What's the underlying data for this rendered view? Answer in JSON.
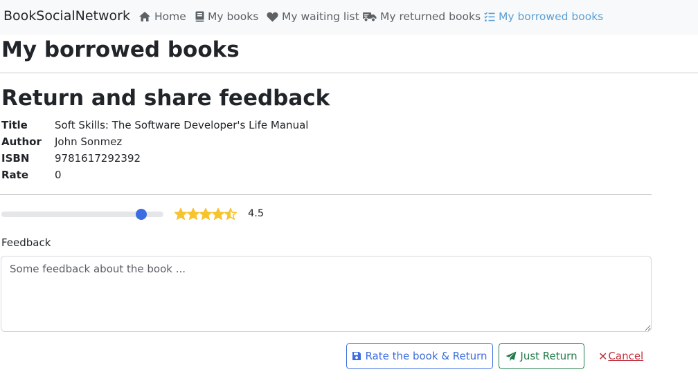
{
  "navbar": {
    "brand": "BookSocialNetwork",
    "items": [
      {
        "label": "Home",
        "icon": "home-icon",
        "active": false
      },
      {
        "label": "My books",
        "icon": "book-icon",
        "active": false
      },
      {
        "label": "My waiting list",
        "icon": "heart-icon",
        "active": false
      },
      {
        "label": "My returned books",
        "icon": "truck-icon",
        "active": false
      },
      {
        "label": "My borrowed books",
        "icon": "list-check-icon",
        "active": true
      }
    ]
  },
  "page": {
    "title": "My borrowed books",
    "section_title": "Return and share feedback"
  },
  "book": {
    "title_label": "Title",
    "title_value": "Soft Skills: The Software Developer's Life Manual",
    "author_label": "Author",
    "author_value": "John Sonmez",
    "isbn_label": "ISBN",
    "isbn_value": "9781617292392",
    "rate_label": "Rate",
    "rate_value": "0"
  },
  "rating": {
    "value": 4.5,
    "max": 5,
    "display": "4.5",
    "star_color": "#f7c32e"
  },
  "feedback": {
    "label": "Feedback",
    "placeholder": "Some feedback about the book ...",
    "value": ""
  },
  "actions": {
    "rate_return_label": "Rate the book & Return",
    "just_return_label": "Just Return",
    "cancel_label": "Cancel",
    "cancel_symbol": "✕"
  },
  "colors": {
    "primary": "#3b6de0",
    "success": "#1f7a48",
    "danger": "#c0303d",
    "nav_active": "#5a9fd4"
  }
}
